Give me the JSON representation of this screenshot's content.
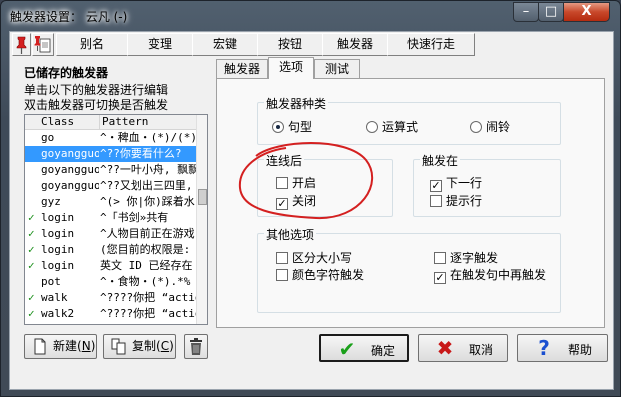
{
  "window": {
    "title": "触发器设置： 云凡 (-)",
    "controls": {
      "minimize": "–",
      "maximize": "□",
      "close": "X"
    }
  },
  "top_tabs": [
    {
      "label": "别名"
    },
    {
      "label": "变理"
    },
    {
      "label": "宏键"
    },
    {
      "label": "按钮"
    },
    {
      "label": "触发器"
    },
    {
      "label": "快速行走"
    }
  ],
  "left_panel": {
    "heading": "已储存的触发器",
    "line1": "单击以下的触发器进行编辑",
    "line2": "双击触发器可切换是否触发",
    "columns": [
      "Class",
      "Pattern"
    ],
    "rows": [
      {
        "checked": false,
        "class": "go",
        "pattern": "^・稗血・(*)/(*)",
        "selected": false
      },
      {
        "checked": false,
        "class": "goyangguo",
        "pattern": "^??你要看什么?",
        "selected": true
      },
      {
        "checked": false,
        "class": "goyangguo",
        "pattern": "^??一叶小舟, 飘飘",
        "selected": false
      },
      {
        "checked": false,
        "class": "goyangguo",
        "pattern": "^??又划出三四里,",
        "selected": false
      },
      {
        "checked": false,
        "class": "gyz",
        "pattern": "^(> 你|你)踩着水",
        "selected": false
      },
      {
        "checked": true,
        "class": "login",
        "pattern": "^「书剑»共有",
        "selected": false
      },
      {
        "checked": true,
        "class": "login",
        "pattern": "^人物目前正在游戏",
        "selected": false
      },
      {
        "checked": true,
        "class": "login",
        "pattern": "(您目前的权限是:",
        "selected": false
      },
      {
        "checked": true,
        "class": "login",
        "pattern": "英文 ID 已经存在",
        "selected": false
      },
      {
        "checked": false,
        "class": "pot",
        "pattern": "^・食物・(*).*%",
        "selected": false
      },
      {
        "checked": true,
        "class": "walk",
        "pattern": "^????你把 “actio",
        "selected": false
      },
      {
        "checked": true,
        "class": "walk2",
        "pattern": "^????你把 “actio",
        "selected": false
      }
    ],
    "buttons": {
      "new": "新建",
      "new_key": "N",
      "copy": "复制",
      "copy_key": "C"
    }
  },
  "right_tabs": [
    {
      "label": "触发器"
    },
    {
      "label": "选项"
    },
    {
      "label": "测试"
    }
  ],
  "options": {
    "trigger_type": {
      "title": "触发器种类",
      "options": [
        "句型",
        "运算式",
        "闹铃"
      ],
      "selected": "句型"
    },
    "multiline": {
      "title": "连线后",
      "on_label": "开启",
      "on_checked": false,
      "off_label": "关闭",
      "off_checked": true
    },
    "trigger_at": {
      "title": "触发在",
      "next_line_label": "下一行",
      "next_line_checked": true,
      "prompt_label": "提示行",
      "prompt_checked": false
    },
    "other": {
      "title": "其他选项",
      "case_label": "区分大小写",
      "case_checked": false,
      "perchar_label": "逐字触发",
      "perchar_checked": false,
      "color_label": "颜色字符触发",
      "color_checked": false,
      "retrigger_label": "在触发句中再触发",
      "retrigger_checked": true
    }
  },
  "footer": {
    "ok": "确定",
    "cancel": "取消",
    "help": "帮助"
  },
  "colors": {
    "selection": "#3399ff",
    "annotation": "#d42020",
    "check_green": "#1a8f1a"
  }
}
